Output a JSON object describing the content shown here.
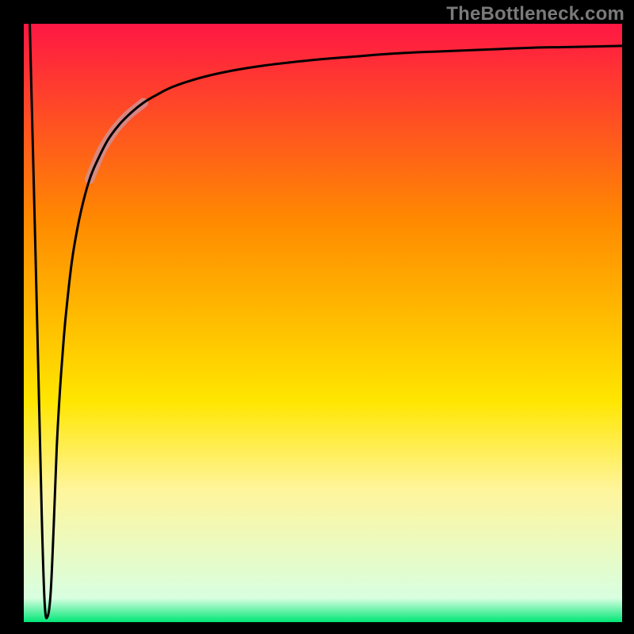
{
  "watermark": "TheBottleneck.com",
  "chart_data": {
    "type": "line",
    "title": "",
    "xlabel": "",
    "ylabel": "",
    "xlim": [
      0,
      100
    ],
    "ylim": [
      0,
      100
    ],
    "grid": false,
    "legend": false,
    "gradient_stops": [
      {
        "offset": 0.0,
        "color": "#ff1744"
      },
      {
        "offset": 0.33,
        "color": "#ff8a00"
      },
      {
        "offset": 0.63,
        "color": "#ffe600"
      },
      {
        "offset": 0.78,
        "color": "#fff59d"
      },
      {
        "offset": 0.96,
        "color": "#d8ffe0"
      },
      {
        "offset": 1.0,
        "color": "#00e676"
      }
    ],
    "series": [
      {
        "name": "curve",
        "color": "#000000",
        "x": [
          1,
          2,
          3,
          3.5,
          4,
          4.5,
          5,
          5.5,
          6,
          6.5,
          7,
          8,
          9,
          10,
          11,
          12,
          14,
          16,
          18,
          20,
          22,
          25,
          30,
          35,
          40,
          45,
          50,
          55,
          60,
          65,
          70,
          75,
          80,
          85,
          90,
          95,
          100
        ],
        "values": [
          100,
          60,
          18,
          3,
          1,
          5,
          16,
          29,
          38,
          45,
          51,
          60,
          66,
          70.5,
          74,
          76.5,
          80.5,
          83.2,
          85.2,
          86.8,
          88.0,
          89.5,
          91.1,
          92.2,
          93.0,
          93.6,
          94.1,
          94.5,
          94.9,
          95.2,
          95.4,
          95.6,
          95.8,
          96.0,
          96.1,
          96.2,
          96.3
        ]
      },
      {
        "name": "highlight",
        "color": "#d08f93",
        "x": [
          11,
          12,
          13,
          14,
          15,
          16,
          17,
          18,
          19,
          20
        ],
        "values": [
          74,
          76.5,
          78.8,
          80.5,
          82.0,
          83.2,
          84.3,
          85.2,
          86.0,
          86.8
        ]
      }
    ]
  }
}
